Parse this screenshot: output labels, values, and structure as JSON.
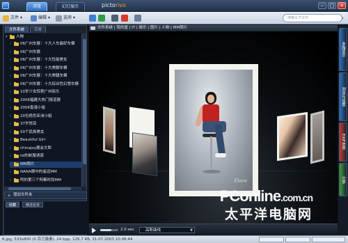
{
  "window": {
    "tabs": [
      "浏览",
      "幻灯展示"
    ],
    "app_title": "picto",
    "app_title_sub": "rivo",
    "buttons": {
      "minimize": "–",
      "maximize": "□",
      "close": "×"
    }
  },
  "toolbar": {
    "file_label": "文件",
    "edit_label": "编辑",
    "options_label": "选项",
    "search_placeholder": "搜索以下文件",
    "search_go": "›"
  },
  "left_panel": {
    "tabs": [
      "文件系统",
      "日本"
    ],
    "root_label": "人物",
    "tree_items": [
      "06广州车展：十大人车最好车模",
      "06广州车展",
      "06广州车展：十大性能美女",
      "06广州车展：十大美脚车模",
      "06广州车展：十大美腿车模",
      "06广州车展：十大综合性幻想车模",
      "10岁少女惊艳广州街头",
      "2006福建大热门报道展",
      "2006香港小姐",
      "20位绝色亚洲小姐",
      "37岁悦耳",
      "50个民族美女",
      "Beautiful Girl",
      "chinajoy展会文郎",
      "lol的制服诱惑",
      "MM照片",
      "NANA眼中的遥远MM",
      "阿的第三个阿都时尚MM"
    ],
    "selected_index": 15,
    "add_folder_label": "增加文件夹",
    "bottom_tabs": [
      "收藏",
      "精选名单"
    ]
  },
  "main": {
    "breadcrumb": "文件系统  |  我的盘  |  IT  |  娱乐  |  图片  |  人物  |  MM照片",
    "signature": "Flare",
    "watermark_line1": "PConline",
    "watermark_line1_suffix": ".com.cn",
    "watermark_line2": "太平洋电脑网",
    "play": {
      "seconds": "2.0 sec",
      "effect": "高斯曲线",
      "slider_fraction": 0.6
    }
  },
  "right_tabs": [
    {
      "label": "多路显示",
      "color": "#2d6fbf"
    },
    {
      "label": "浏览与设置",
      "color": "#2d6fbf"
    },
    {
      "label": "EXIF信息",
      "color": "#c23a2f"
    },
    {
      "label": "分享",
      "color": "#3f9d3a"
    }
  ],
  "status": {
    "text": "6.jpg, 533x800 (0 百万像素), 24 bpp, 126.7 KB, 31.07.2003 10:06:44"
  }
}
